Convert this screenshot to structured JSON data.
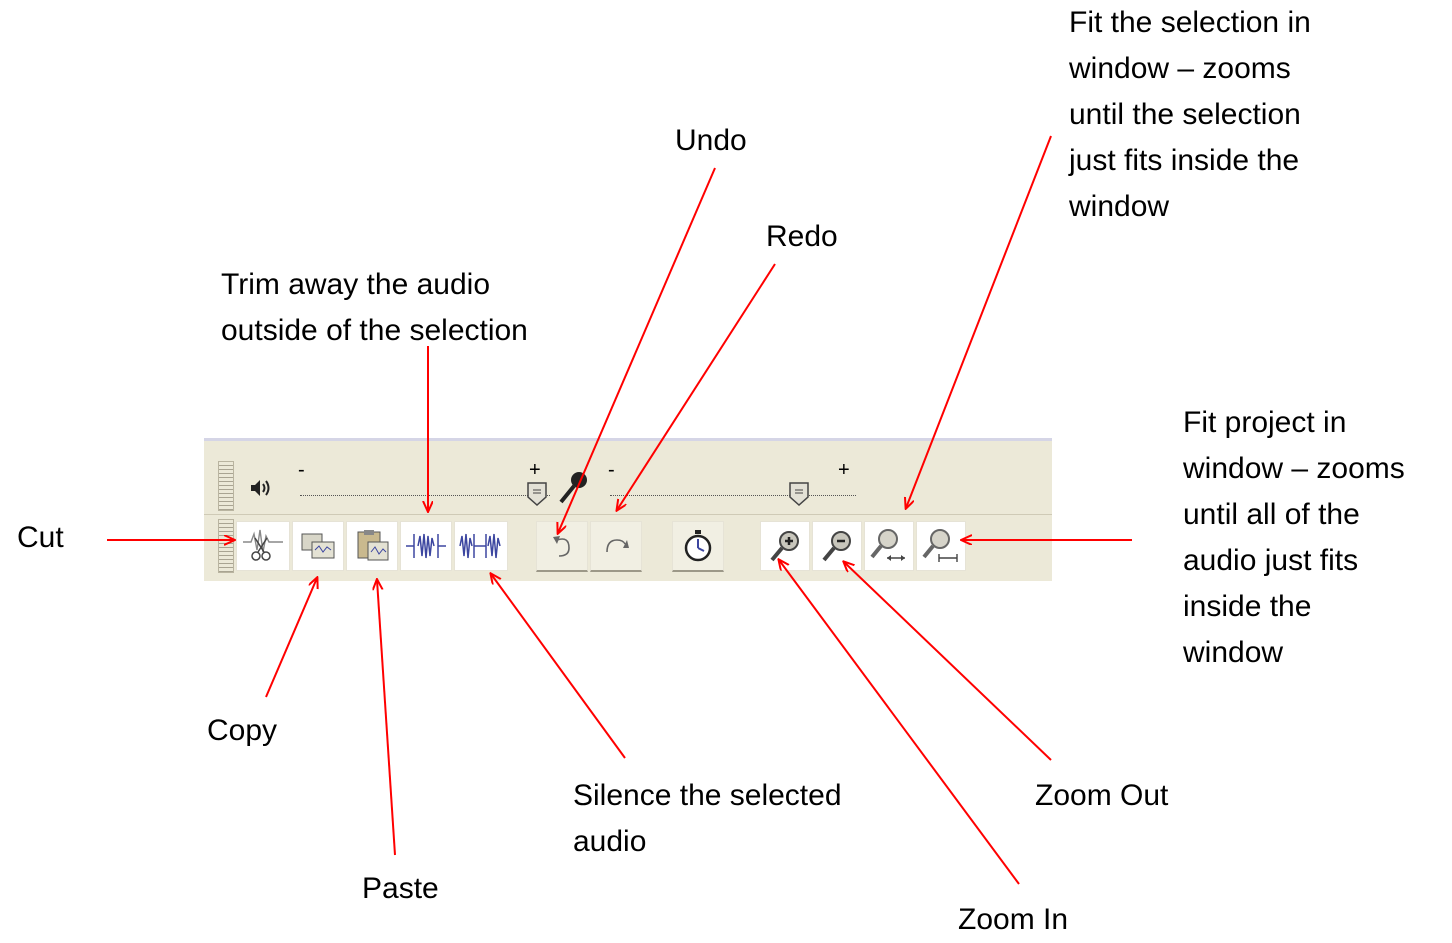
{
  "labels": {
    "cut": "Cut",
    "copy": "Copy",
    "paste": "Paste",
    "trim": "Trim away the audio\noutside of the selection",
    "silence": "Silence the selected\naudio",
    "undo": "Undo",
    "redo": "Redo",
    "fit_selection": "Fit the selection in\nwindow – zooms\nuntil the selection\njust fits inside the\nwindow",
    "fit_project": "Fit project in\nwindow – zooms\nuntil all of the\naudio just fits\ninside the\nwindow",
    "zoom_in": "Zoom In",
    "zoom_out": "Zoom Out"
  },
  "toolbar": {
    "slider_minus": "-",
    "slider_plus": "+",
    "icons": [
      "speaker-icon",
      "microphone-icon",
      "cut-icon",
      "copy-icon",
      "paste-icon",
      "trim-icon",
      "silence-icon",
      "undo-icon",
      "redo-icon",
      "sync-lock-icon",
      "zoom-in-icon",
      "zoom-out-icon",
      "fit-selection-icon",
      "fit-project-icon"
    ]
  },
  "colors": {
    "arrow": "#ff0000",
    "toolbar_bg": "#ece9d8",
    "icon_blue": "#3c46a0"
  }
}
